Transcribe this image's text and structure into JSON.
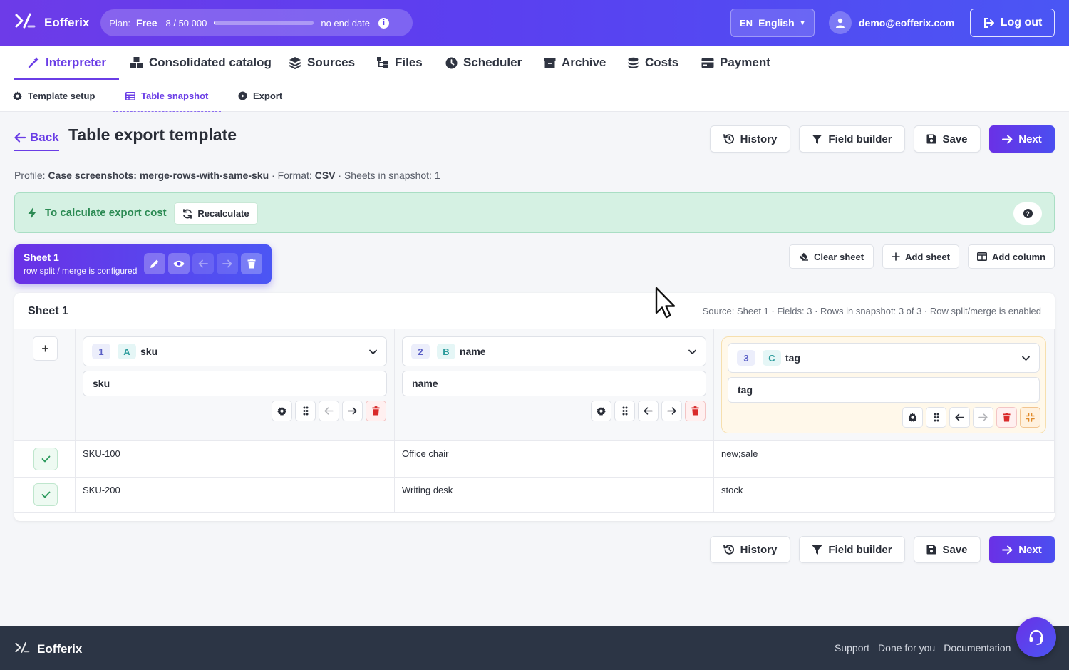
{
  "app": {
    "name": "Eofferix"
  },
  "plan": {
    "label": "Plan:",
    "name": "Free",
    "usage": "8 / 50 000",
    "usage_fraction": 0.00016,
    "end": "no end date"
  },
  "language": {
    "code": "EN",
    "name": "English"
  },
  "user": {
    "email": "demo@eofferix.com",
    "logout": "Log out"
  },
  "nav": {
    "interpreter": "Interpreter",
    "catalog": "Consolidated catalog",
    "sources": "Sources",
    "files": "Files",
    "scheduler": "Scheduler",
    "archive": "Archive",
    "costs": "Costs",
    "payment": "Payment"
  },
  "subnav": {
    "template_setup": "Template setup",
    "table_snapshot": "Table snapshot",
    "export": "Export"
  },
  "page": {
    "back": "Back",
    "title": "Table export template"
  },
  "actions": {
    "history": "History",
    "field_builder": "Field builder",
    "save": "Save",
    "next": "Next"
  },
  "meta": {
    "profile_label": "Profile:",
    "profile_value": "Case screenshots: merge-rows-with-same-sku",
    "format_label": "Format:",
    "format_value": "CSV",
    "sheets": "Sheets in snapshot: 1"
  },
  "banner": {
    "text": "To calculate export cost",
    "recalculate": "Recalculate"
  },
  "sheet_tab": {
    "name": "Sheet 1",
    "subtitle": "row split / merge is configured"
  },
  "sheet_actions": {
    "clear": "Clear sheet",
    "add_sheet": "Add sheet",
    "add_column": "Add column"
  },
  "card": {
    "title": "Sheet 1",
    "meta": "Source: Sheet 1 · Fields: 3 · Rows in snapshot: 3 of 3 · Row split/merge is enabled"
  },
  "columns": [
    {
      "num": "1",
      "letter": "A",
      "field": "sku",
      "header": "sku"
    },
    {
      "num": "2",
      "letter": "B",
      "field": "name",
      "header": "name"
    },
    {
      "num": "3",
      "letter": "C",
      "field": "tag",
      "header": "tag"
    }
  ],
  "rows": [
    [
      "SKU-100",
      "Office chair",
      "new;sale"
    ],
    [
      "SKU-200",
      "Writing desk",
      "stock"
    ]
  ],
  "footer": {
    "brand": "Eofferix",
    "links": [
      "Support",
      "Done for you",
      "Documentation"
    ]
  },
  "colors": {
    "accent": "#6a3de6",
    "banner_bg": "#d5f1e3",
    "banner_text": "#2b8a53",
    "danger": "#d92b2b"
  }
}
